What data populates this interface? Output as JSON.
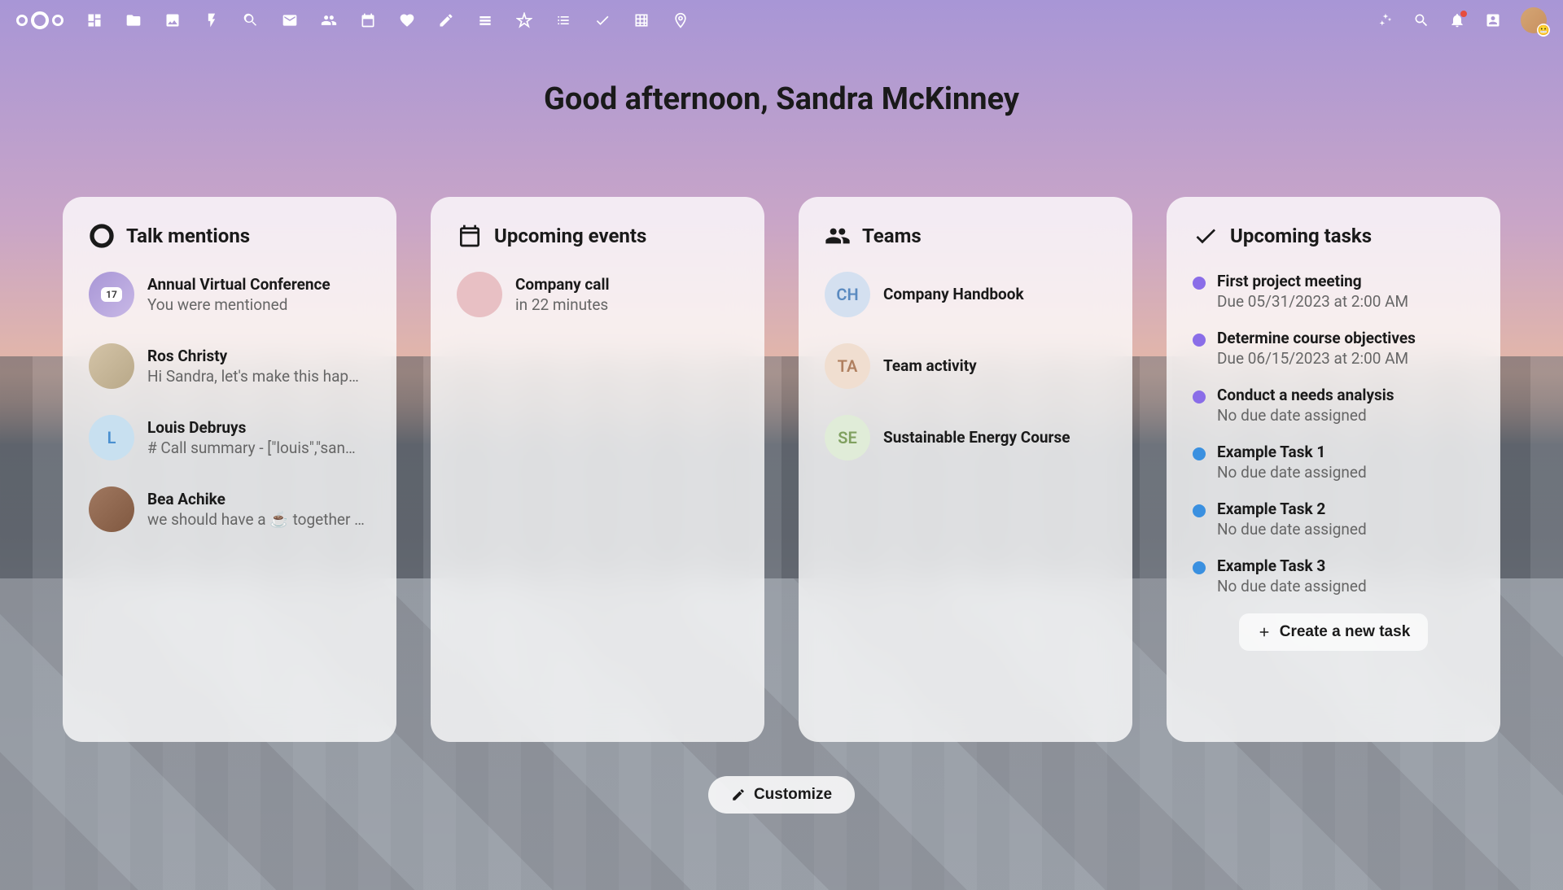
{
  "greeting": "Good afternoon, Sandra McKinney",
  "nav": {
    "icons": [
      "dashboard",
      "files",
      "photos",
      "activity",
      "talk",
      "mail",
      "contacts",
      "calendar",
      "health",
      "notes",
      "deck",
      "featured",
      "lists",
      "tasks",
      "tables",
      "maps"
    ]
  },
  "widgets": {
    "talk": {
      "title": "Talk mentions",
      "items": [
        {
          "title": "Annual Virtual Conference",
          "sub": "You were mentioned",
          "avatar_type": "cal",
          "avatar_text": "17"
        },
        {
          "title": "Ros Christy",
          "sub": "Hi Sandra, let's make this hap…",
          "avatar_type": "photo",
          "avatar_bg": "#c8b8a0"
        },
        {
          "title": "Louis Debruys",
          "sub": "# Call summary - [\"louis\",\"san…",
          "avatar_type": "letter",
          "avatar_text": "L",
          "avatar_bg": "#c8e0f0",
          "avatar_color": "#4a90d0"
        },
        {
          "title": "Bea Achike",
          "sub": "we should have a ☕ together …",
          "avatar_type": "photo",
          "avatar_bg": "#8a6050"
        }
      ]
    },
    "events": {
      "title": "Upcoming events",
      "items": [
        {
          "title": "Company call",
          "sub": "in 22 minutes",
          "avatar_bg": "#e8c0c4"
        }
      ]
    },
    "teams": {
      "title": "Teams",
      "items": [
        {
          "title": "Company Handbook",
          "avatar_text": "CH",
          "avatar_bg": "#d4e0f0",
          "avatar_color": "#5a8ac0"
        },
        {
          "title": "Team activity",
          "avatar_text": "TA",
          "avatar_bg": "#f0ded0",
          "avatar_color": "#b08060"
        },
        {
          "title": "Sustainable Energy Course",
          "avatar_text": "SE",
          "avatar_bg": "#e0ecd8",
          "avatar_color": "#80a060"
        }
      ]
    },
    "tasks": {
      "title": "Upcoming tasks",
      "items": [
        {
          "title": "First project meeting",
          "sub": "Due 05/31/2023 at 2:00 AM",
          "color": "#8a6de8"
        },
        {
          "title": "Determine course objectives",
          "sub": "Due 06/15/2023 at 2:00 AM",
          "color": "#8a6de8"
        },
        {
          "title": "Conduct a needs analysis",
          "sub": "No due date assigned",
          "color": "#8a6de8"
        },
        {
          "title": "Example Task 1",
          "sub": "No due date assigned",
          "color": "#3a90e0"
        },
        {
          "title": "Example Task 2",
          "sub": "No due date assigned",
          "color": "#3a90e0"
        },
        {
          "title": "Example Task 3",
          "sub": "No due date assigned",
          "color": "#3a90e0"
        }
      ],
      "create_label": "Create a new task"
    }
  },
  "customize_label": "Customize"
}
